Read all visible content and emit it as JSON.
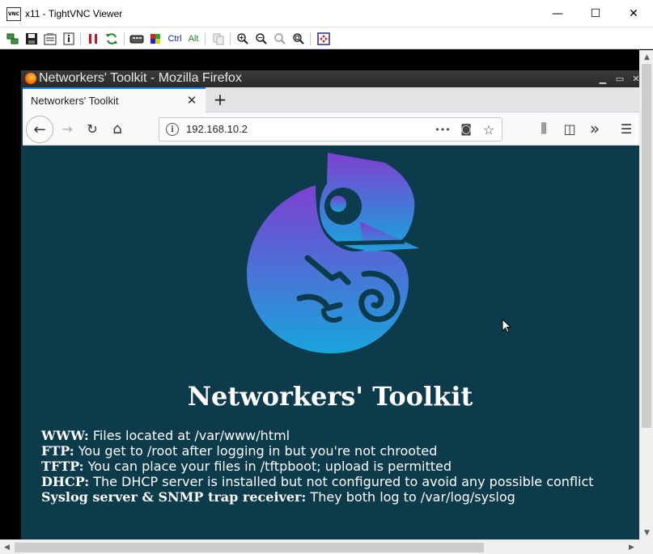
{
  "vnc": {
    "app_icon_text": "VNC",
    "title": "x11 - TightVNC Viewer",
    "controls": {
      "minimize": "—",
      "maximize": "☐",
      "close": "✕"
    },
    "toolbar": {
      "ctrl_label": "Ctrl",
      "alt_label": "Alt",
      "icons": [
        "new-connection-icon",
        "save-icon",
        "options-icon",
        "info-icon",
        "pause-icon",
        "refresh-icon",
        "ctrl-alt-del-icon",
        "ctrl-esc-icon",
        "copy-icon",
        "zoom-in-icon",
        "zoom-out-icon",
        "zoom-100-icon",
        "zoom-fit-icon",
        "fullscreen-icon"
      ]
    },
    "scroll": {
      "up": "▲",
      "down": "▼",
      "left": "◀",
      "right": "▶"
    }
  },
  "firefox": {
    "window_title": "Networkers' Toolkit - Mozilla Firefox",
    "controls": {
      "minimize": "▁",
      "maximize": "▭",
      "close": "✕"
    },
    "tab": {
      "label": "Networkers' Toolkit",
      "close": "✕"
    },
    "new_tab": "+",
    "nav": {
      "back": "←",
      "forward": "→",
      "reload": "↻",
      "home": "⌂"
    },
    "url": "192.168.10.2",
    "url_actions": {
      "page_actions": "•••",
      "pocket": "◙",
      "bookmark": "☆"
    },
    "toolbar_right": {
      "library": "⫼",
      "sidebar": "◫",
      "overflow": "»",
      "menu": "☰"
    }
  },
  "page": {
    "heading": "Networkers' Toolkit",
    "items": [
      {
        "key": "WWW:",
        "value": " Files located at /var/www/html"
      },
      {
        "key": "FTP:",
        "value": " You get to /root after logging in but you're not chrooted"
      },
      {
        "key": "TFTP:",
        "value": " You can place your files in /tftpboot; upload is permitted"
      },
      {
        "key": "DHCP:",
        "value": " The DHCP server is installed but not configured to avoid any possible conflict"
      },
      {
        "key": "Syslog server & SNMP trap receiver:",
        "value": " They both log to /var/log/syslog"
      }
    ]
  },
  "colors": {
    "page_bg": "#0c3b4c",
    "logo_top": "#7e3fd1",
    "logo_bottom": "#18a5dc",
    "firefox_accent": "#0a84ff"
  }
}
